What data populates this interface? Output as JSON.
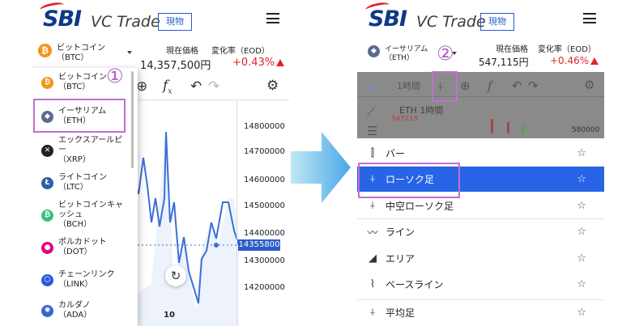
{
  "brand": {
    "sbi": "SBI",
    "vc": "VC Trade",
    "spot_badge": "現物"
  },
  "colors": {
    "brand_blue": "#0c3a8a",
    "accent_blue": "#2764e6",
    "up_red": "#e0262b",
    "highlight": "#c070d0"
  },
  "left": {
    "coin": {
      "name": "ビットコイン",
      "symbol": "（BTC）"
    },
    "price_label": "現在価格",
    "change_label": "変化率（EOD）",
    "price": "14,357,500円",
    "change": "+0.43%",
    "marker": "①",
    "dropdown": [
      {
        "name": "ビットコイン",
        "symbol": "（BTC）",
        "icon": "bitcoin-icon",
        "color": "#f7931a",
        "glyph": "₿"
      },
      {
        "name": "イーサリアム",
        "symbol": "（ETH）",
        "icon": "ethereum-icon",
        "color": "#5b6b8f",
        "glyph": "◆"
      },
      {
        "name": "エックスアールピ ー",
        "symbol": "（XRP）",
        "icon": "xrp-icon",
        "color": "#222222",
        "glyph": "✕"
      },
      {
        "name": "ライトコイン",
        "symbol": "（LTC）",
        "icon": "litecoin-icon",
        "color": "#2f5fa8",
        "glyph": "Ł"
      },
      {
        "name": "ビットコインキャ ッシュ",
        "symbol": "（BCH）",
        "icon": "bitcoin-cash-icon",
        "color": "#3bbf7a",
        "glyph": "₿"
      },
      {
        "name": "ポルカドット",
        "symbol": "（DOT）",
        "icon": "polkadot-icon",
        "color": "#e6007a",
        "glyph": "●"
      },
      {
        "name": "チェーンリンク",
        "symbol": "（LINK）",
        "icon": "chainlink-icon",
        "color": "#2a5ada",
        "glyph": "⬡"
      },
      {
        "name": "カルダノ",
        "symbol": "（ADA）",
        "icon": "cardano-icon",
        "color": "#3468d1",
        "glyph": "✺"
      }
    ],
    "y_ticks": [
      "14800000",
      "14700000",
      "14600000",
      "14500000",
      "14400000",
      "14300000",
      "14200000"
    ],
    "current_price_tag": "14355800",
    "x_tick": "10"
  },
  "right": {
    "coin": {
      "name": "イーサリアム",
      "symbol": "（ETH）"
    },
    "price_label": "現在価格",
    "change_label": "変化率（EOD）",
    "price": "547,115円",
    "change": "+0.46%",
    "marker": "②",
    "interval": "1時間",
    "chart_title": "ETH 1時間",
    "chart_value": "547215",
    "y_tick": "580000",
    "chart_types": [
      {
        "label": "バー",
        "icon": "bar-chart-icon",
        "glyph": "⫿"
      },
      {
        "label": "ローソク足",
        "icon": "candlestick-icon",
        "glyph": "⍭"
      },
      {
        "label": "中空ローソク足",
        "icon": "hollow-candlestick-icon",
        "glyph": "⍭"
      },
      {
        "label": "ライン",
        "icon": "line-chart-icon",
        "glyph": "〰"
      },
      {
        "label": "エリア",
        "icon": "area-chart-icon",
        "glyph": "◢"
      },
      {
        "label": "ベースライン",
        "icon": "baseline-chart-icon",
        "glyph": "⌇"
      },
      {
        "label": "平均足",
        "icon": "heikin-ashi-icon",
        "glyph": "⍭"
      }
    ],
    "selected_chart_type": "ローソク足"
  }
}
